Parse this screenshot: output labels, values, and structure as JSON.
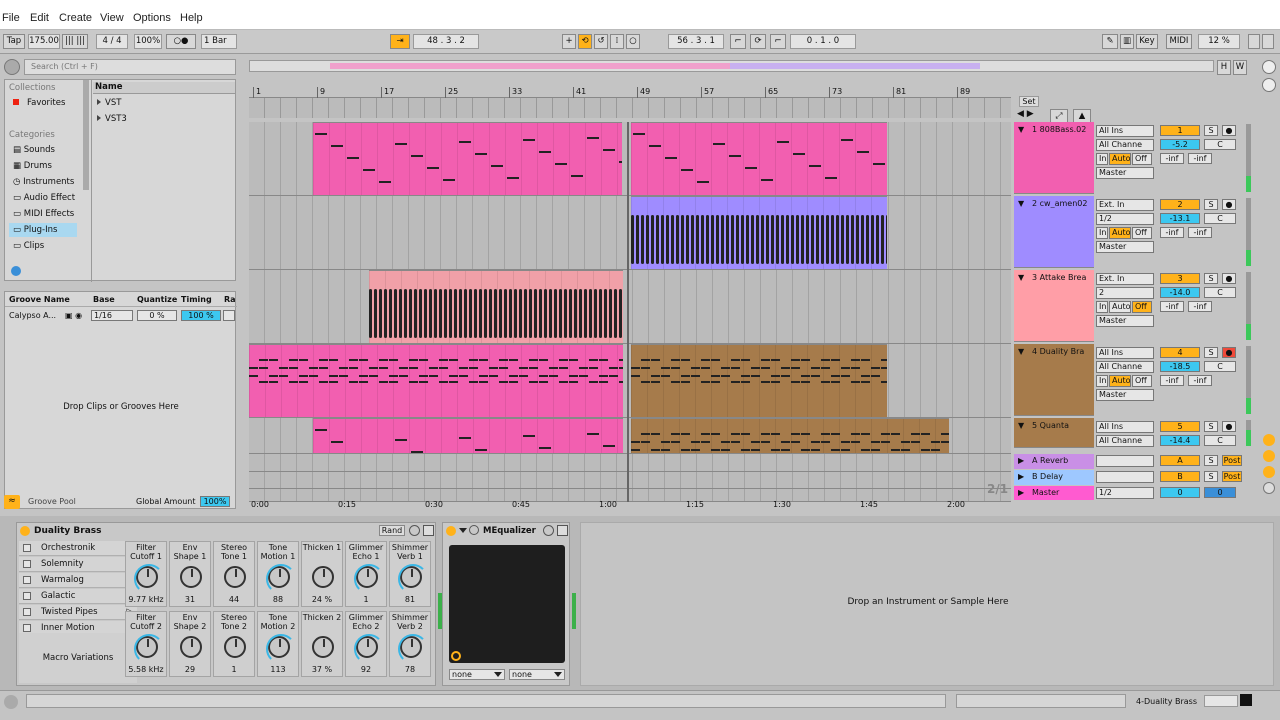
{
  "menu": [
    "File",
    "Edit",
    "Create",
    "View",
    "Options",
    "Help"
  ],
  "control": {
    "tap": "Tap",
    "tempo": "175.00",
    "sig": "4 / 4",
    "zoom": "100%",
    "metro": "○●",
    "quant": "1 Bar",
    "pos": "48 .   3 .   2",
    "pos2": "56 .   3 .   1",
    "len": "0 .   1 .   0",
    "key": "Key",
    "midi": "MIDI",
    "cpu": "12 %"
  },
  "browser": {
    "search_placeholder": "Search (Ctrl + F)",
    "collections_title": "Collections",
    "favorites": "Favorites",
    "categories_title": "Categories",
    "categories": [
      "Sounds",
      "Drums",
      "Instruments",
      "Audio Effects",
      "MIDI Effects",
      "Plug-Ins",
      "Clips"
    ],
    "name_header": "Name",
    "items": [
      "VST",
      "VST3"
    ]
  },
  "groove": {
    "headers": [
      "Groove Name",
      "Base",
      "Quantize",
      "Timing",
      "Ra"
    ],
    "row_name": "Calypso A...",
    "row_base": "1/16",
    "row_quantize": "0 %",
    "row_timing": "100 %",
    "drop_text": "Drop Clips or Grooves Here",
    "pool_label": "Groove Pool",
    "global_label": "Global Amount",
    "global_value": "100%"
  },
  "ruler": [
    "1",
    "9",
    "17",
    "25",
    "33",
    "41",
    "49",
    "57",
    "65",
    "73",
    "81",
    "89"
  ],
  "time_ruler": [
    "0:00",
    "0:15",
    "0:30",
    "0:45",
    "1:00",
    "1:15",
    "1:30",
    "1:45",
    "2:00"
  ],
  "page_indicator": "2/1",
  "set_label": "Set",
  "tracks": [
    {
      "name": "1 808Bass.02",
      "color": "#f25fb0",
      "input": "All Ins",
      "channel": "All Channe",
      "monitor": "Auto",
      "out": "Master",
      "num": "1",
      "vol": "-5.2",
      "pan": "C",
      "send1": "-inf",
      "send2": "-inf"
    },
    {
      "name": "2 cw_amen02",
      "color": "#9f8cff",
      "input": "Ext. In",
      "channel": "1/2",
      "monitor": "Auto",
      "out": "Master",
      "num": "2",
      "vol": "-13.1",
      "pan": "C",
      "send1": "-inf",
      "send2": "-inf"
    },
    {
      "name": "3 Attake Brea",
      "color": "#ff9ea7",
      "input": "Ext. In",
      "channel": "2",
      "monitor": "Off",
      "out": "Master",
      "num": "3",
      "vol": "-14.0",
      "pan": "C",
      "send1": "-inf",
      "send2": "-inf"
    },
    {
      "name": "4 Duality Bra",
      "color": "#a67b4b",
      "input": "All Ins",
      "channel": "All Channe",
      "monitor": "Auto",
      "out": "Master",
      "num": "4",
      "vol": "-18.5",
      "pan": "C",
      "send1": "-inf",
      "send2": "-inf"
    },
    {
      "name": "5 Quanta",
      "color": "#a67b4b",
      "input": "All Ins",
      "channel": "All Channe",
      "num": "5",
      "vol": "-14.4",
      "pan": "C"
    }
  ],
  "returns": [
    {
      "name": "A Reverb",
      "letter": "A",
      "post": "Post",
      "color": "#c98fe6"
    },
    {
      "name": "B Delay",
      "letter": "B",
      "post": "Post",
      "color": "#9ec8ff"
    }
  ],
  "master": {
    "name": "Master",
    "channel": "1/2",
    "vol": "0",
    "pan": "0",
    "color": "#ff5bd0"
  },
  "mix_labels": {
    "in": "In",
    "auto": "Auto",
    "off": "Off",
    "solo": "S"
  },
  "rack": {
    "title": "Duality Brass",
    "rand": "Rand",
    "macro_variations": "Macro Variations",
    "list": [
      "Orchestronik",
      "Solemnity",
      "Warmalog",
      "Galactic",
      "Twisted Pipes",
      "Inner Motion"
    ],
    "macros_top": [
      {
        "l": "Filter Cutoff 1",
        "v": "9.77 kHz"
      },
      {
        "l": "Env Shape 1",
        "v": "31"
      },
      {
        "l": "Stereo Tone 1",
        "v": "44"
      },
      {
        "l": "Tone Motion 1",
        "v": "88"
      },
      {
        "l": "Thicken 1",
        "v": "24 %"
      },
      {
        "l": "Glimmer Echo 1",
        "v": "1"
      },
      {
        "l": "Shimmer Verb 1",
        "v": "81"
      }
    ],
    "macros_bottom": [
      {
        "l": "Filter Cutoff 2",
        "v": "5.58 kHz"
      },
      {
        "l": "Env Shape 2",
        "v": "29"
      },
      {
        "l": "Stereo Tone 2",
        "v": "1"
      },
      {
        "l": "Tone Motion 2",
        "v": "113"
      },
      {
        "l": "Thicken 2",
        "v": "37 %"
      },
      {
        "l": "Glimmer Echo 2",
        "v": "92"
      },
      {
        "l": "Shimmer Verb 2",
        "v": "78"
      }
    ]
  },
  "meq": {
    "title": "MEqualizer",
    "sel1": "none",
    "sel2": "none"
  },
  "drop_instrument": "Drop an Instrument or Sample Here",
  "status": {
    "track": "4-Duality Brass"
  }
}
